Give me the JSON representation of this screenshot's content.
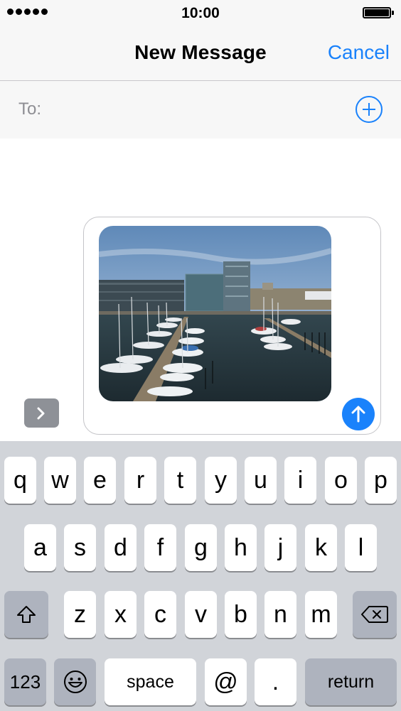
{
  "status_bar": {
    "time": "10:00",
    "signal_dots": 5
  },
  "nav": {
    "title": "New Message",
    "cancel_label": "Cancel"
  },
  "recipient": {
    "label": "To:"
  },
  "keyboard": {
    "row1": [
      "q",
      "w",
      "e",
      "r",
      "t",
      "y",
      "u",
      "i",
      "o",
      "p"
    ],
    "row2": [
      "a",
      "s",
      "d",
      "f",
      "g",
      "h",
      "j",
      "k",
      "l"
    ],
    "row3": [
      "z",
      "x",
      "c",
      "v",
      "b",
      "n",
      "m"
    ],
    "numbers_label": "123",
    "space_label": "space",
    "at_label": "@",
    "period_label": ".",
    "return_label": "return"
  },
  "icons": {
    "add_contact": "plus-circle-icon",
    "expand": "chevron-right-icon",
    "send": "arrow-up-icon",
    "shift": "shift-icon",
    "delete": "backspace-icon",
    "emoji": "smiley-icon"
  },
  "colors": {
    "accent": "#1a82fb",
    "keyboard_bg": "#d1d4d9",
    "bar_bg": "#f7f7f7"
  }
}
